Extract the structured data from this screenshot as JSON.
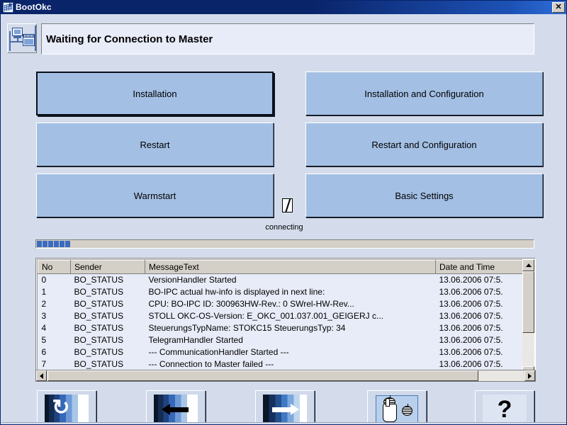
{
  "window": {
    "title": "BootOkc",
    "icon": "app-grid-icon",
    "close_label": "✕"
  },
  "header": {
    "icon": "machine-network-icon",
    "status_text": "Waiting for Connection to Master"
  },
  "actions": {
    "installation": "Installation",
    "installation_and_configuration": "Installation and Configuration",
    "restart": "Restart",
    "restart_and_configuration": "Restart and Configuration",
    "warmstart": "Warmstart",
    "basic_settings": "Basic Settings"
  },
  "progress": {
    "connecting_label": "connecting",
    "blocks": 6,
    "spinner_glyph": "\\"
  },
  "log": {
    "columns": [
      "No",
      "Sender",
      "MessageText",
      "Date and Time"
    ],
    "rows": [
      {
        "no": "0",
        "sender": "BO_STATUS",
        "message": "VersionHandler Started",
        "datetime": "13.06.2006 07:5."
      },
      {
        "no": "1",
        "sender": "BO_STATUS",
        "message": "BO-IPC actual hw-info is displayed in next line:",
        "datetime": "13.06.2006 07:5."
      },
      {
        "no": "2",
        "sender": "BO_STATUS",
        "message": "CPU: BO-IPC ID: 300963HW-Rev.: 0 SWrel-HW-Rev...",
        "datetime": "13.06.2006 07:5."
      },
      {
        "no": "3",
        "sender": "BO_STATUS",
        "message": "STOLL OKC-OS-Version: E_OKC_001.037.001_GEIGERJ c...",
        "datetime": "13.06.2006 07:5."
      },
      {
        "no": "4",
        "sender": "BO_STATUS",
        "message": "SteuerungsTypName: STOKC15 SteuerungsTyp: 34",
        "datetime": "13.06.2006 07:5."
      },
      {
        "no": "5",
        "sender": "BO_STATUS",
        "message": "TelegramHandler Started",
        "datetime": "13.06.2006 07:5."
      },
      {
        "no": "6",
        "sender": "BO_STATUS",
        "message": "--- CommunicationHandler Started ---",
        "datetime": "13.06.2006 07:5."
      },
      {
        "no": "7",
        "sender": "BO_STATUS",
        "message": "--- Connection to Master failed ---",
        "datetime": "13.06.2006 07:5."
      }
    ]
  },
  "toolbar": {
    "refresh": {
      "name": "refresh-icon",
      "glyph": "↻"
    },
    "back": {
      "name": "arrow-left-icon"
    },
    "forward": {
      "name": "arrow-right-icon"
    },
    "network": {
      "name": "hand-network-icon"
    },
    "help": {
      "name": "question-mark-icon",
      "glyph": "?"
    }
  },
  "colors": {
    "titlebar": "#0a246a",
    "client_bg": "#d4dcec",
    "button_blue": "#a3bfe4",
    "field_bg": "#e8ecf8",
    "progress_blue": "#3a6bbf",
    "header_gray": "#d4d0c8"
  }
}
